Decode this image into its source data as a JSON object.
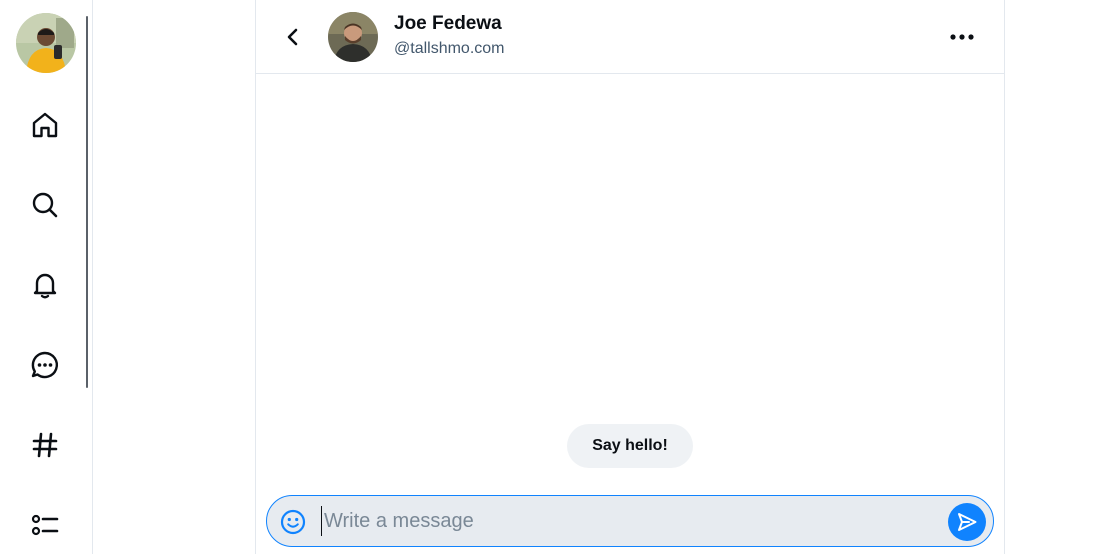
{
  "sidebar": {
    "self_avatar_alt": "",
    "items": [
      {
        "name": "home",
        "icon": "home-icon"
      },
      {
        "name": "search",
        "icon": "search-icon"
      },
      {
        "name": "notifications",
        "icon": "bell-icon"
      },
      {
        "name": "chat",
        "icon": "chat-bubble-icon"
      },
      {
        "name": "feeds",
        "icon": "hashtag-icon"
      },
      {
        "name": "lists",
        "icon": "list-icon"
      }
    ]
  },
  "conversation": {
    "partner_name": "Joe Fedewa",
    "partner_handle": "@tallshmo.com",
    "prompt_chip": "Say hello!",
    "input_placeholder": "Write a message",
    "input_value": ""
  },
  "colors": {
    "accent": "#1083fe",
    "border": "#e3e8ee",
    "chip_bg": "#eff2f5",
    "composer_bg": "#e7ebf0",
    "text": "#0b0f14",
    "muted": "#42576c"
  }
}
